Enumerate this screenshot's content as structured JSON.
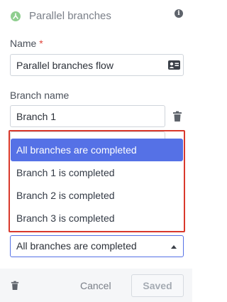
{
  "header": {
    "title": "Parallel branches",
    "info_icon": "info-icon",
    "icon": "parallel-branches-icon"
  },
  "name_field": {
    "label": "Name",
    "required_mark": "*",
    "value": "Parallel branches flow"
  },
  "branch_field": {
    "label": "Branch name",
    "value": "Branch 1"
  },
  "dropdown": {
    "options": [
      {
        "label": "All branches are completed",
        "selected": true
      },
      {
        "label": "Branch 1 is completed",
        "selected": false
      },
      {
        "label": "Branch 2 is completed",
        "selected": false
      },
      {
        "label": "Branch 3 is completed",
        "selected": false
      }
    ],
    "selected_value": "All branches are completed"
  },
  "footer": {
    "cancel_label": "Cancel",
    "saved_label": "Saved"
  },
  "colors": {
    "accent": "#5571e6",
    "highlight": "#d9392c",
    "node_icon": "#8fce8f"
  }
}
